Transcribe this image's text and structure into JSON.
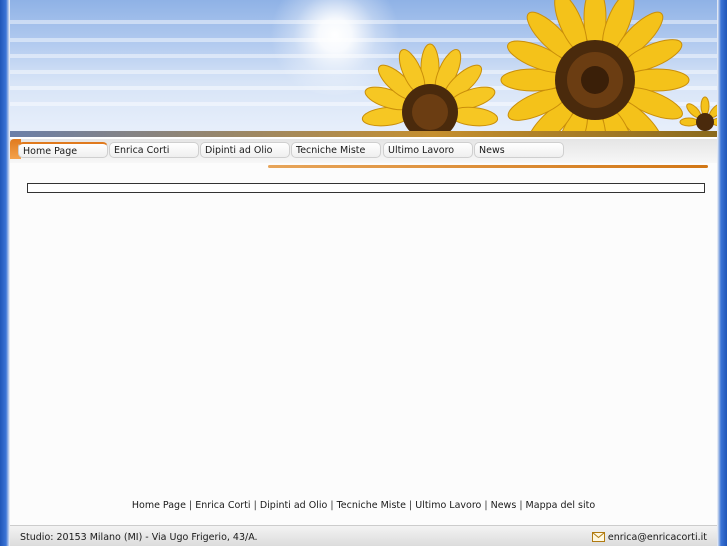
{
  "nav": {
    "items": [
      {
        "label": "Home Page"
      },
      {
        "label": "Enrica Corti"
      },
      {
        "label": "Dipinti ad Olio"
      },
      {
        "label": "Tecniche Miste"
      },
      {
        "label": "Ultimo Lavoro"
      },
      {
        "label": "News"
      }
    ]
  },
  "footer": {
    "links": [
      "Home Page",
      "Enrica Corti",
      "Dipinti ad Olio",
      "Tecniche Miste",
      "Ultimo Lavoro",
      "News",
      "Mappa del sito"
    ],
    "separator": "|"
  },
  "bottom_bar": {
    "address": "Studio: 20153 Milano (MI) - Via Ugo Frigerio, 43/A.",
    "email": "enrica@enricacorti.it",
    "email_icon": "mail-icon"
  },
  "colors": {
    "accent": "#e07a1e",
    "side_border": "#1f55b8"
  }
}
